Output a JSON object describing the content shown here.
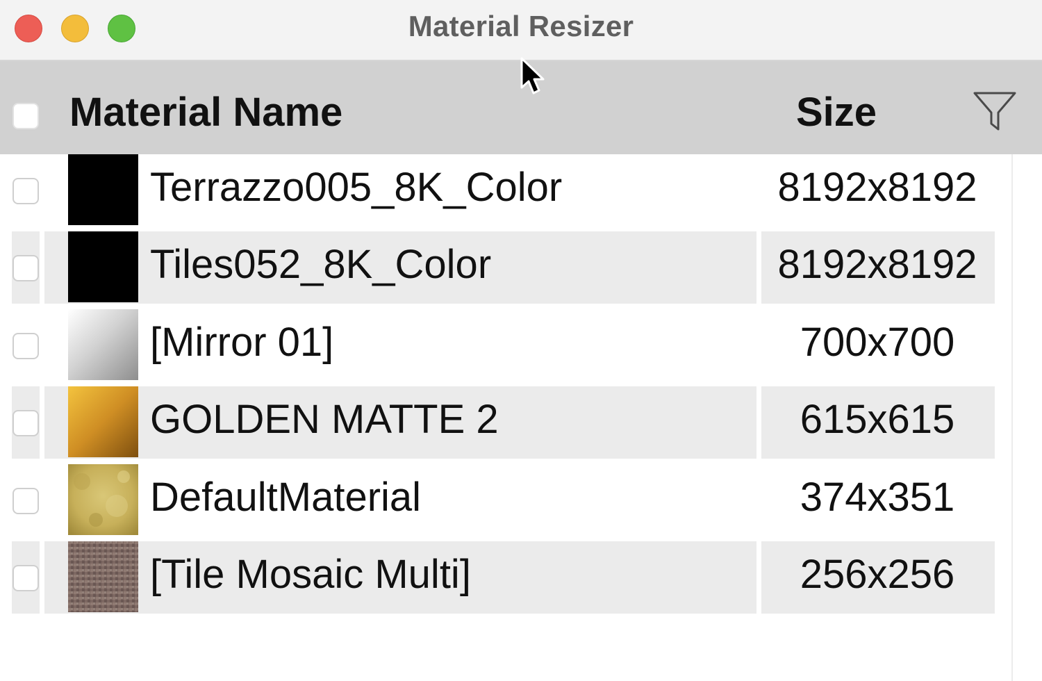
{
  "window": {
    "title": "Material Resizer"
  },
  "header": {
    "name_label": "Material Name",
    "size_label": "Size"
  },
  "rows": [
    {
      "name": "Terrazzo005_8K_Color",
      "size": "8192x8192",
      "swatch": "black"
    },
    {
      "name": "Tiles052_8K_Color",
      "size": "8192x8192",
      "swatch": "black"
    },
    {
      "name": "[Mirror 01]",
      "size": "700x700",
      "swatch": "silver-gradient"
    },
    {
      "name": "GOLDEN MATTE 2",
      "size": "615x615",
      "swatch": "gold-gradient"
    },
    {
      "name": "DefaultMaterial",
      "size": "374x351",
      "swatch": "yellow-texture"
    },
    {
      "name": "[Tile Mosaic Multi]",
      "size": "256x256",
      "swatch": "mosaic-texture"
    }
  ],
  "icons": {
    "close": "close-dot",
    "minimize": "minimize-dot",
    "zoom": "zoom-dot",
    "filter": "filter-icon",
    "cursor": "pointer-cursor"
  },
  "colors": {
    "close": "#ed5e56",
    "minimize": "#f3bd3b",
    "zoom": "#5fc143",
    "header_bg": "#d1d1d1",
    "alt_row_bg": "#ebebeb"
  }
}
